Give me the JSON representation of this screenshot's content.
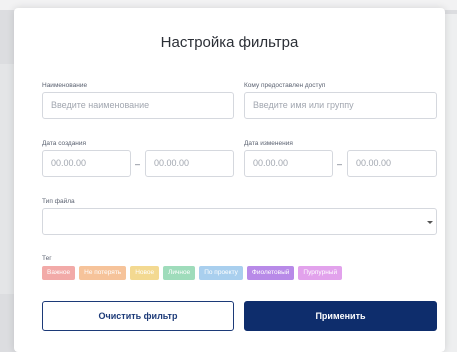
{
  "dialog": {
    "title": "Настройка фильтра"
  },
  "fields": {
    "name": {
      "label": "Наименование",
      "placeholder": "Введите наименование"
    },
    "access": {
      "label": "Кому предоставлен доступ",
      "placeholder": "Введите имя или группу"
    },
    "created": {
      "label": "Дата создания",
      "from": "00.00.00",
      "to": "00.00.00"
    },
    "modified": {
      "label": "Дата изменения",
      "from": "00.00.00",
      "to": "00.00.00"
    },
    "file_type": {
      "label": "Тип файла",
      "value": ""
    },
    "range_separator": "–"
  },
  "tags": {
    "label": "Тег",
    "items": [
      {
        "label": "Важное",
        "color": "#f2aaa8"
      },
      {
        "label": "Не потерять",
        "color": "#f6c39a"
      },
      {
        "label": "Новое",
        "color": "#f3d991"
      },
      {
        "label": "Личное",
        "color": "#9fdcbb"
      },
      {
        "label": "По проекту",
        "color": "#a9cfee"
      },
      {
        "label": "Фиолетовый",
        "color": "#b88ae8"
      },
      {
        "label": "Пурпурный",
        "color": "#e2a2ec"
      }
    ]
  },
  "buttons": {
    "clear": "Очистить фильтр",
    "apply": "Применить"
  },
  "colors": {
    "primary": "#0e2d6c"
  }
}
